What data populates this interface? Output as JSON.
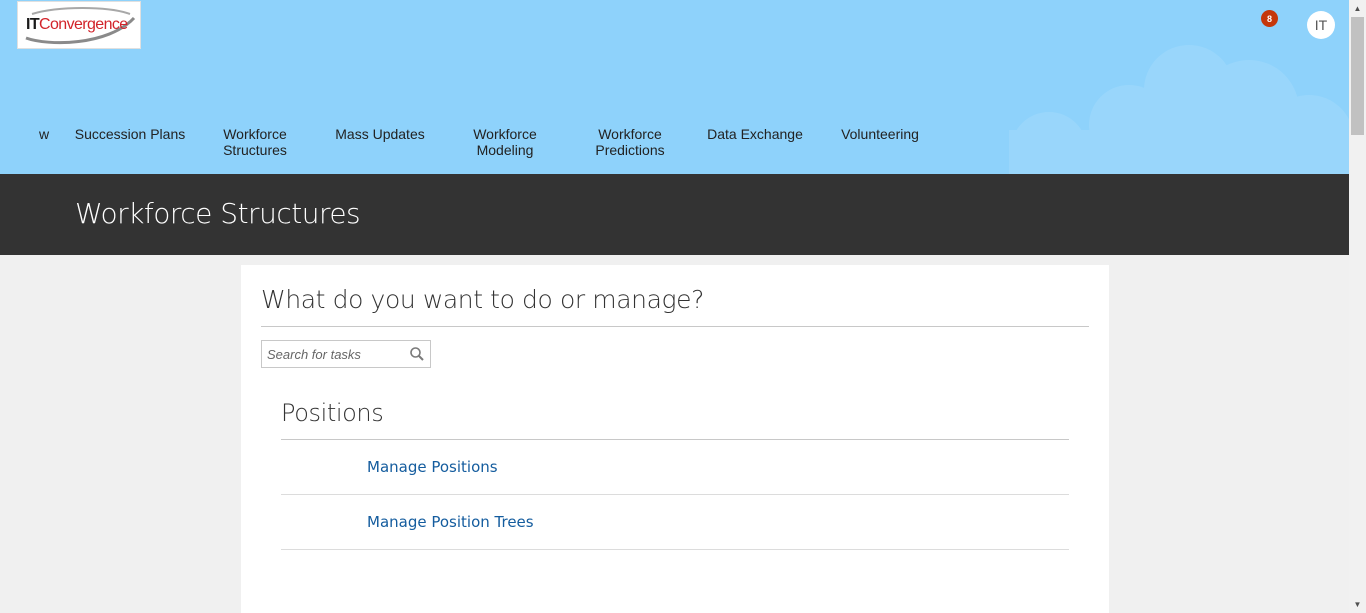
{
  "brand": {
    "logo_it": "IT",
    "logo_rest": "Convergence"
  },
  "header": {
    "notification_count": "8",
    "user_initials": "IT"
  },
  "nav": {
    "items": [
      {
        "label": "w"
      },
      {
        "label": "Succession Plans"
      },
      {
        "label": "Workforce Structures"
      },
      {
        "label": "Mass Updates"
      },
      {
        "label": "Workforce Modeling"
      },
      {
        "label": "Workforce Predictions"
      },
      {
        "label": "Data Exchange"
      },
      {
        "label": "Volunteering"
      }
    ]
  },
  "page": {
    "title": "Workforce Structures"
  },
  "main": {
    "question": "What do you want to do or manage?",
    "search_placeholder": "Search for tasks",
    "search_value": "",
    "section_title": "Positions",
    "tasks": [
      {
        "label": "Manage Positions"
      },
      {
        "label": "Manage Position Trees"
      }
    ]
  },
  "colors": {
    "header_bg": "#8ed2fb",
    "title_band_bg": "#333333",
    "link": "#145c9e",
    "notification_badge": "#c5370b"
  },
  "icons": {
    "search": "search-icon",
    "notification": "notification-badge"
  }
}
